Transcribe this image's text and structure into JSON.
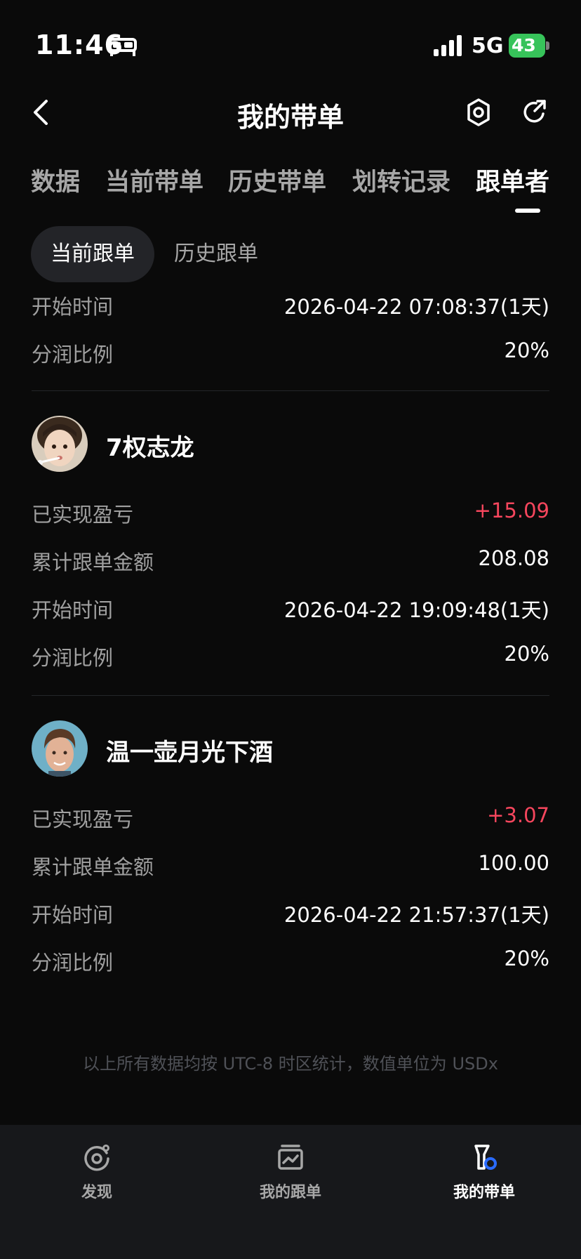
{
  "status_bar": {
    "time": "11:46",
    "network": "5G",
    "battery": "43",
    "icons": [
      "bed-icon",
      "signal-icon",
      "battery-icon"
    ]
  },
  "nav": {
    "title": "我的带单",
    "icons": [
      "back-icon",
      "settings-icon",
      "share-icon"
    ]
  },
  "tabs": [
    {
      "label": "数据"
    },
    {
      "label": "当前带单"
    },
    {
      "label": "历史带单"
    },
    {
      "label": "划转记录"
    },
    {
      "label": "跟单者",
      "active": true
    }
  ],
  "subtabs": [
    {
      "label": "当前跟单",
      "active": true
    },
    {
      "label": "历史跟单"
    }
  ],
  "first_partial": {
    "start_label": "开始时间",
    "start_value": "2026-04-22 07:08:37(1天)",
    "share_label": "分润比例",
    "share_value": "20%"
  },
  "followers": [
    {
      "name": "7权志龙",
      "pnl_label": "已实现盈亏",
      "pnl_value": "+15.09",
      "amount_label": "累计跟单金额",
      "amount_value": "208.08",
      "start_label": "开始时间",
      "start_value": "2026-04-22 19:09:48(1天)",
      "share_label": "分润比例",
      "share_value": "20%"
    },
    {
      "name": "温一壶月光下酒",
      "pnl_label": "已实现盈亏",
      "pnl_value": "+3.07",
      "amount_label": "累计跟单金额",
      "amount_value": "100.00",
      "start_label": "开始时间",
      "start_value": "2026-04-22 21:57:37(1天)",
      "share_label": "分润比例",
      "share_value": "20%"
    }
  ],
  "footnote": "以上所有数据均按 UTC-8 时区统计，数值单位为 USDx",
  "bottom_nav": [
    {
      "label": "发现",
      "icon": "discover-icon"
    },
    {
      "label": "我的跟单",
      "icon": "copy-trade-icon"
    },
    {
      "label": "我的带单",
      "icon": "lead-trade-icon",
      "active": true
    }
  ],
  "colors": {
    "background": "#0a0a0a",
    "profit": "#f6465d",
    "battery": "#37c35a",
    "active_indicator": "#2a6bff"
  }
}
